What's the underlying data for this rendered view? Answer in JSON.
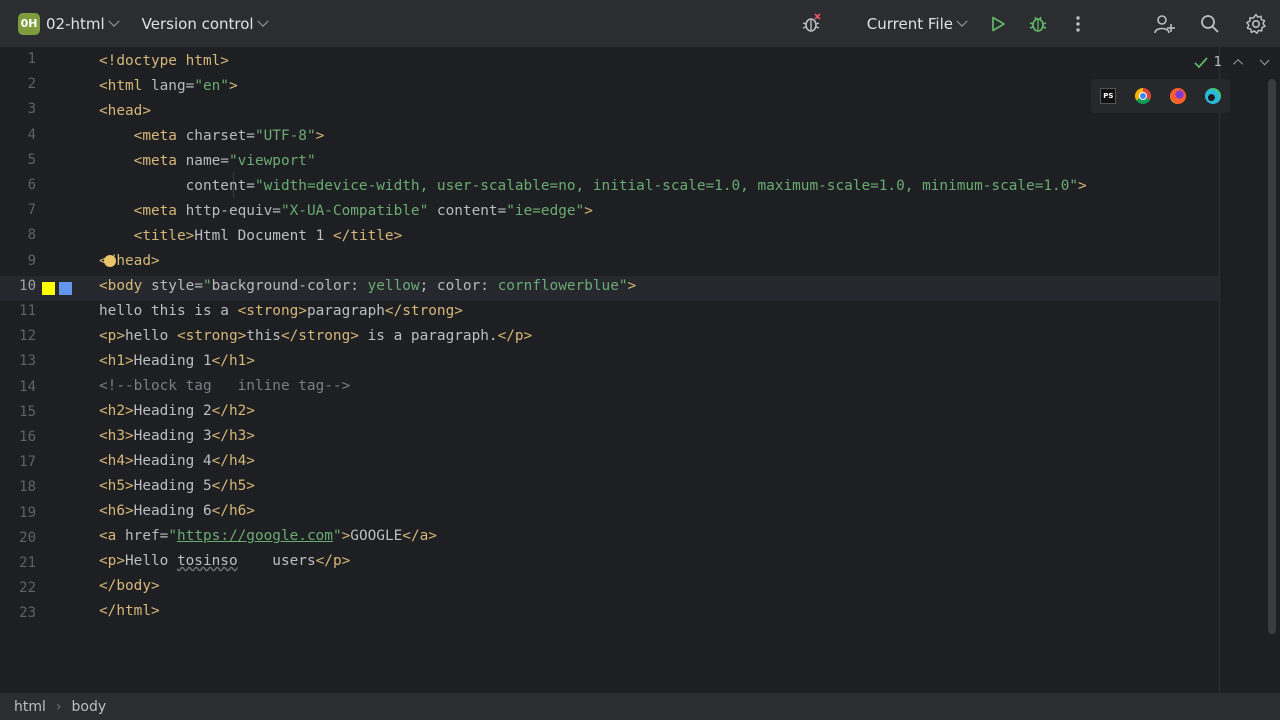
{
  "project": {
    "badge": "0H",
    "name": "02-html"
  },
  "vcs": {
    "label": "Version control"
  },
  "run_config": {
    "label": "Current File"
  },
  "inspection": {
    "count": "1"
  },
  "icons": {
    "run": "play-icon",
    "debug": "bug-icon",
    "more": "more-vertical-icon",
    "add_user": "add-user-icon",
    "search": "search-icon",
    "settings": "gear-icon",
    "code_with_me": "code-with-me-icon"
  },
  "browsers": [
    "phpstorm-icon",
    "chrome-icon",
    "firefox-icon",
    "edge-icon"
  ],
  "current_line": "10",
  "line_numbers": [
    "1",
    "2",
    "3",
    "4",
    "5",
    "6",
    "7",
    "8",
    "9",
    "10",
    "11",
    "12",
    "13",
    "14",
    "15",
    "16",
    "17",
    "18",
    "19",
    "20",
    "21",
    "22",
    "23"
  ],
  "code": {
    "l1": [
      "<!doctype html>"
    ],
    "l2": [
      "<html ",
      "lang",
      "=",
      "\"en\"",
      ">"
    ],
    "l3": [
      "<head>"
    ],
    "l4": [
      "    ",
      "<meta ",
      "charset",
      "=",
      "\"UTF-8\"",
      ">"
    ],
    "l5": [
      "    ",
      "<meta ",
      "name",
      "=",
      "\"viewport\""
    ],
    "l6": [
      "          ",
      "content",
      "=",
      "\"width=device-width, user-scalable=no, initial-scale=1.0, maximum-scale=1.0, minimum-scale=1.0\"",
      ">"
    ],
    "l7": [
      "    ",
      "<meta ",
      "http-equiv",
      "=",
      "\"X-UA-Compatible\"",
      " ",
      "content",
      "=",
      "\"ie=edge\"",
      ">"
    ],
    "l8": [
      "    ",
      "<title>",
      "Html Document 1 ",
      "</title>"
    ],
    "l9": [
      "</head>"
    ],
    "l10": [
      "<body ",
      "style",
      "=",
      "\"",
      "background-color",
      ": ",
      "yellow",
      "; ",
      "color",
      ": ",
      "cornflowerblue",
      "\"",
      ">"
    ],
    "l11": [
      "hello this is a ",
      "<strong>",
      "paragraph",
      "</strong>"
    ],
    "l12": [
      "<p>",
      "hello ",
      "<strong>",
      "this",
      "</strong>",
      " is a paragraph.",
      "</p>"
    ],
    "l13": [
      "<h1>",
      "Heading 1",
      "</h1>"
    ],
    "l14": [
      "<!--block tag   inline tag-->"
    ],
    "l15": [
      "<h2>",
      "Heading 2",
      "</h2>"
    ],
    "l16": [
      "<h3>",
      "Heading 3",
      "</h3>"
    ],
    "l17": [
      "<h4>",
      "Heading 4",
      "</h4>"
    ],
    "l18": [
      "<h5>",
      "Heading 5",
      "</h5>"
    ],
    "l19": [
      "<h6>",
      "Heading 6",
      "</h6>"
    ],
    "l20": [
      "<a ",
      "href",
      "=",
      "\"",
      "https://google.com",
      "\"",
      ">",
      "GOOGLE",
      "</a>"
    ],
    "l21": [
      "<p>",
      "Hello ",
      "tosinso",
      "    users",
      "</p>"
    ],
    "l22": [
      "</body>"
    ],
    "l23": [
      "</html>"
    ]
  },
  "breadcrumbs": [
    "html",
    "body"
  ],
  "colors": {
    "yellow_marker": "#ffff00",
    "blue_marker": "#6495ed",
    "accent_tag": "#d5b778",
    "string": "#6aab73"
  }
}
